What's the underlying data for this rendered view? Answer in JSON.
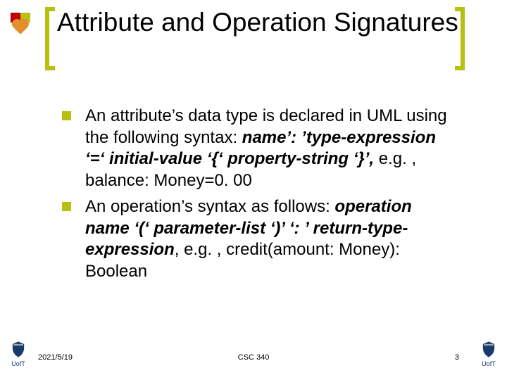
{
  "title": "Attribute and Operation Signatures",
  "bullets": [
    {
      "lead": "An attribute’s data type is declared in UML using the following syntax: ",
      "syntax": "name’: ’type-expression ‘=‘ initial-value ‘{‘ property-string ‘}’,",
      "tail": " e.g. , balance: Money=0. 00"
    },
    {
      "lead": "An operation’s syntax as follows: ",
      "syntax": "operation name ‘(‘ parameter-list ‘)’ ‘: ’ return-type-expression",
      "tail": ", e.g. , credit(amount: Money): Boolean"
    }
  ],
  "footer": {
    "date": "2021/5/19",
    "course": "CSC 340",
    "page": "3",
    "crest_label": "UofT"
  }
}
